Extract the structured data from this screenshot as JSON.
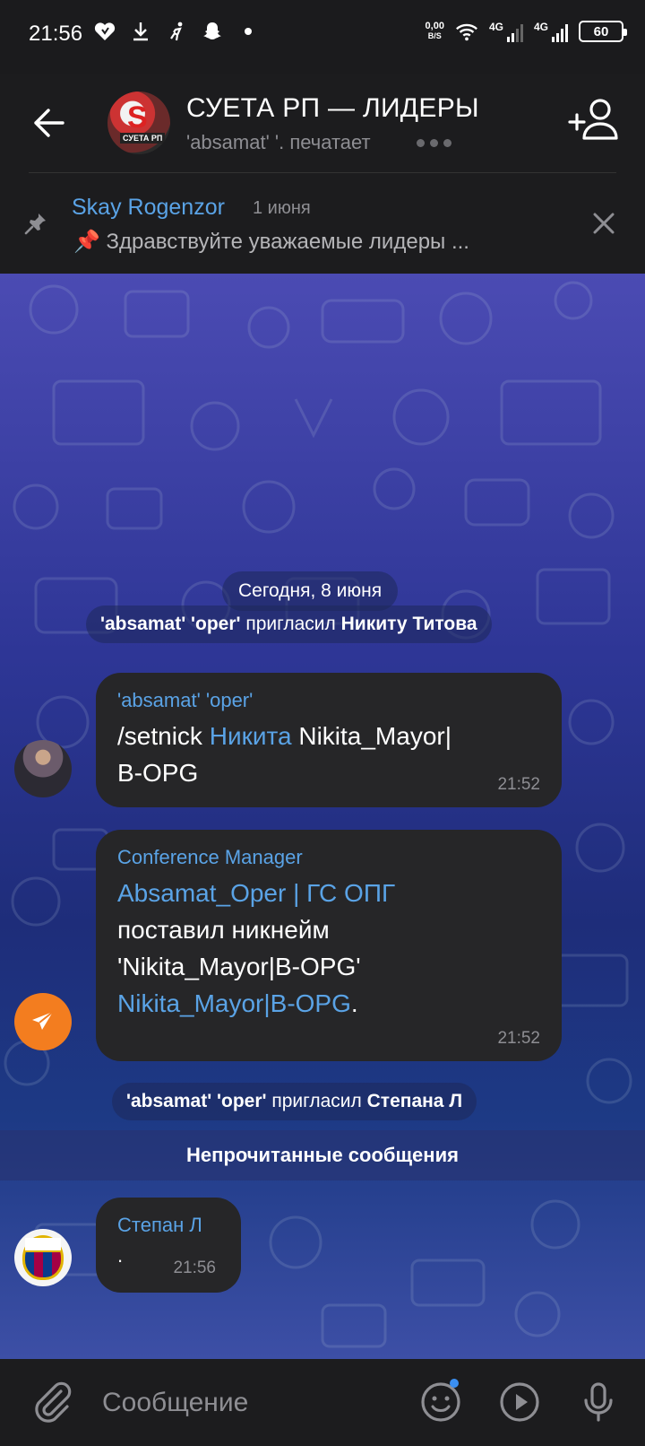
{
  "status_bar": {
    "time": "21:56",
    "net_speed_value": "0,00",
    "net_speed_unit": "B/S",
    "net_type_1": "4G",
    "net_type_2": "4G",
    "battery": "60"
  },
  "header": {
    "title": "СУЕТА РП — ЛИДЕРЫ",
    "subtitle": "'absamat' '. печатает",
    "avatar_text": "СУЕТА РП"
  },
  "pinned": {
    "author": "Skay Rogenzor",
    "date": "1 июня",
    "text": "📌 Здравствуйте уважаемые лидеры ..."
  },
  "chat": {
    "date_separator": "Сегодня, 8 июня",
    "service_1": {
      "actor": "'absamat' 'oper'",
      "action": "пригласил",
      "target": "Никиту Титова"
    },
    "message_1": {
      "name": "'absamat' 'oper'",
      "text_cmd": "/setnick",
      "text_link": "Никита",
      "text_rest": "Nikita_Mayor|",
      "text_line2": "B-OPG",
      "time": "21:52"
    },
    "message_2": {
      "name": "Conference Manager",
      "link_1": "Absamat_Oper | ГС ОПГ",
      "line_2": "поставил никнейм",
      "line_3": "'Nikita_Mayor|B-OPG'",
      "link_2": "Nikita_Mayor|B-OPG",
      "tail": ".",
      "time": "21:52"
    },
    "service_2": {
      "actor": "'absamat' 'oper'",
      "action": "пригласил",
      "target": "Степана Л"
    },
    "unread_label": "Непрочитанные сообщения",
    "message_3": {
      "name": "Степан Л",
      "text": ".",
      "time": "21:56"
    }
  },
  "input": {
    "placeholder": "Сообщение"
  },
  "colors": {
    "accent": "#5aa3e6",
    "bubble": "#262628",
    "bar": "#1c1c1e"
  }
}
